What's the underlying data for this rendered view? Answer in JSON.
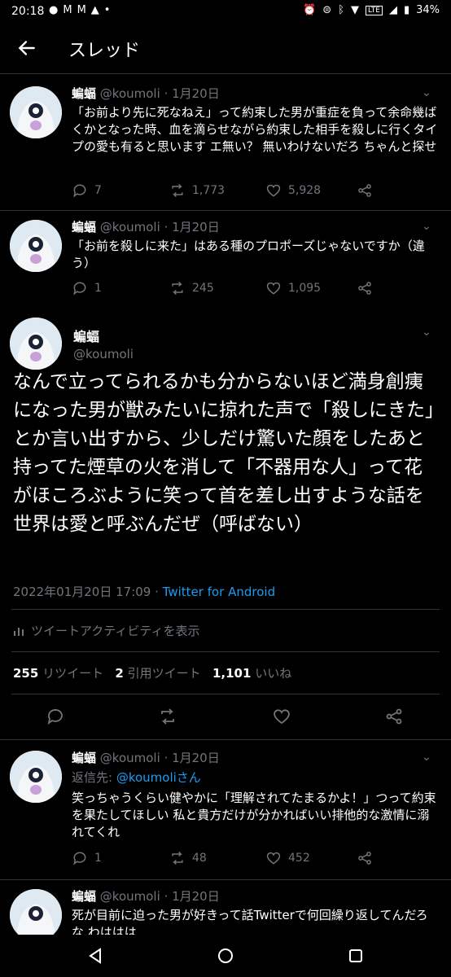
{
  "status": {
    "time": "20:18",
    "battery": "34%",
    "net": "LTE"
  },
  "appbar": {
    "title": "スレッド"
  },
  "tweets": [
    {
      "name": "蝙蝠",
      "handle": "@koumoli",
      "date": "· 1月20日",
      "text": "「お前より先に死なねえ」って約束した男が重症を負って余命幾ばくかとなった時、血を滴らせながら約束した相手を殺しに行くタイプの愛も有ると思います エ無い？ 無いわけないだろ ちゃんと探せ",
      "replies": "7",
      "retweets": "1,773",
      "likes": "5,928"
    },
    {
      "name": "蝙蝠",
      "handle": "@koumoli",
      "date": "· 1月20日",
      "text": "「お前を殺しに来た」はある種のプロポーズじゃないですか（違う）",
      "replies": "1",
      "retweets": "245",
      "likes": "1,095"
    }
  ],
  "main": {
    "name": "蝙蝠",
    "handle": "@koumoli",
    "text": "なんで立ってられるかも分からないほど満身創痍になった男が獣みたいに掠れた声で「殺しにきた」とか言い出すから、少しだけ驚いた顔をしたあと持ってた煙草の火を消して「不器用な人」って花がほころぶように笑って首を差し出すような話を世界は愛と呼ぶんだぜ（呼ばない）",
    "timestamp": "2022年01月20日 17:09 · ",
    "client": "Twitter for Android",
    "activity": "ツイートアクティビティを表示",
    "retweets": "255",
    "retweets_label": "リツイート",
    "quotes": "2",
    "quotes_label": "引用ツイート",
    "likes": "1,101",
    "likes_label": "いいね"
  },
  "reply1": {
    "name": "蝙蝠",
    "handle": "@koumoli",
    "date": "· 1月20日",
    "reply_to_label": "返信先: ",
    "reply_to": "@koumoliさん",
    "text": "笑っちゃうくらい健やかに「理解されてたまるかよ！」つって約束を果たしてほしい 私と貴方だけが分かればいい排他的な激情に溺れてくれ",
    "replies": "1",
    "retweets": "48",
    "likes": "452"
  },
  "reply2": {
    "name": "蝙蝠",
    "handle": "@koumoli",
    "date": "· 1月20日",
    "text": "死が目前に迫った男が好きって話Twitterで何回繰り返してんだろな わははは"
  }
}
